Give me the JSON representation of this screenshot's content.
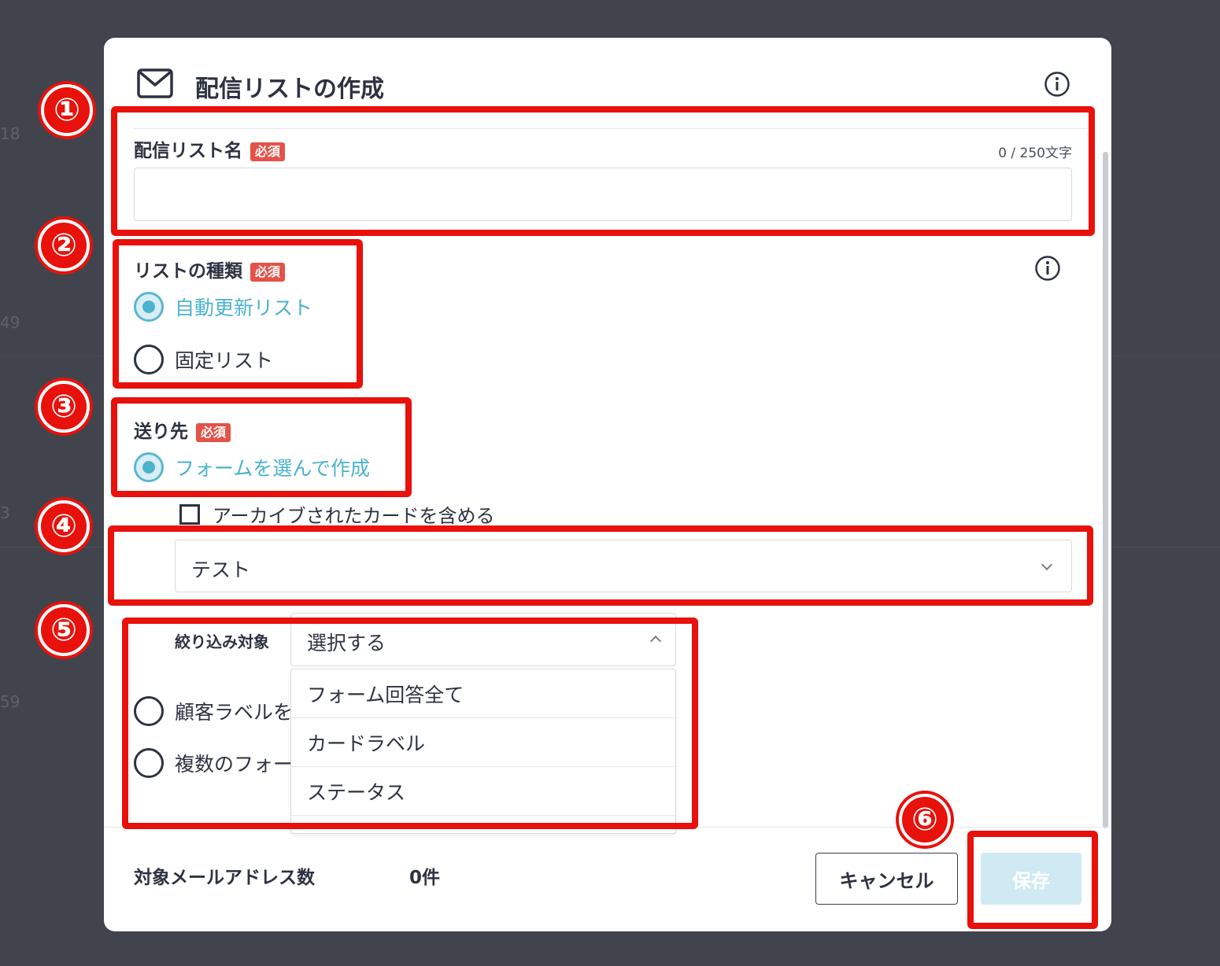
{
  "background": {
    "row_numbers": [
      "18",
      "49",
      "3",
      "59"
    ]
  },
  "modal": {
    "title": "配信リストの作成",
    "list_name": {
      "label": "配信リスト名",
      "required_badge": "必須",
      "counter": "0 / 250文字",
      "value": ""
    },
    "list_type": {
      "label": "リストの種類",
      "required_badge": "必須",
      "options": [
        {
          "label": "自動更新リスト",
          "checked": true
        },
        {
          "label": "固定リスト",
          "checked": false
        }
      ]
    },
    "destination": {
      "label": "送り先",
      "required_badge": "必須",
      "option_form": "フォームを選んで作成",
      "include_archived": "アーカイブされたカードを含める",
      "form_select_value": "テスト",
      "filter_label": "絞り込み対象",
      "filter_value": "選択する",
      "filter_options": [
        "フォーム回答全て",
        "カードラベル",
        "ステータス"
      ],
      "option_customer_label": "顧客ラベルを",
      "option_multi_form": "複数のフォー"
    },
    "footer": {
      "target_label": "対象メールアドレス数",
      "target_count": "0件",
      "cancel_label": "キャンセル",
      "save_label": "保存"
    }
  },
  "annotations": [
    "①",
    "②",
    "③",
    "④",
    "⑤",
    "⑥"
  ],
  "colors": {
    "accent": "#4db2cd",
    "required": "#e55248",
    "annotation": "#e8110b",
    "save_disabled": "#cfeaf2"
  }
}
